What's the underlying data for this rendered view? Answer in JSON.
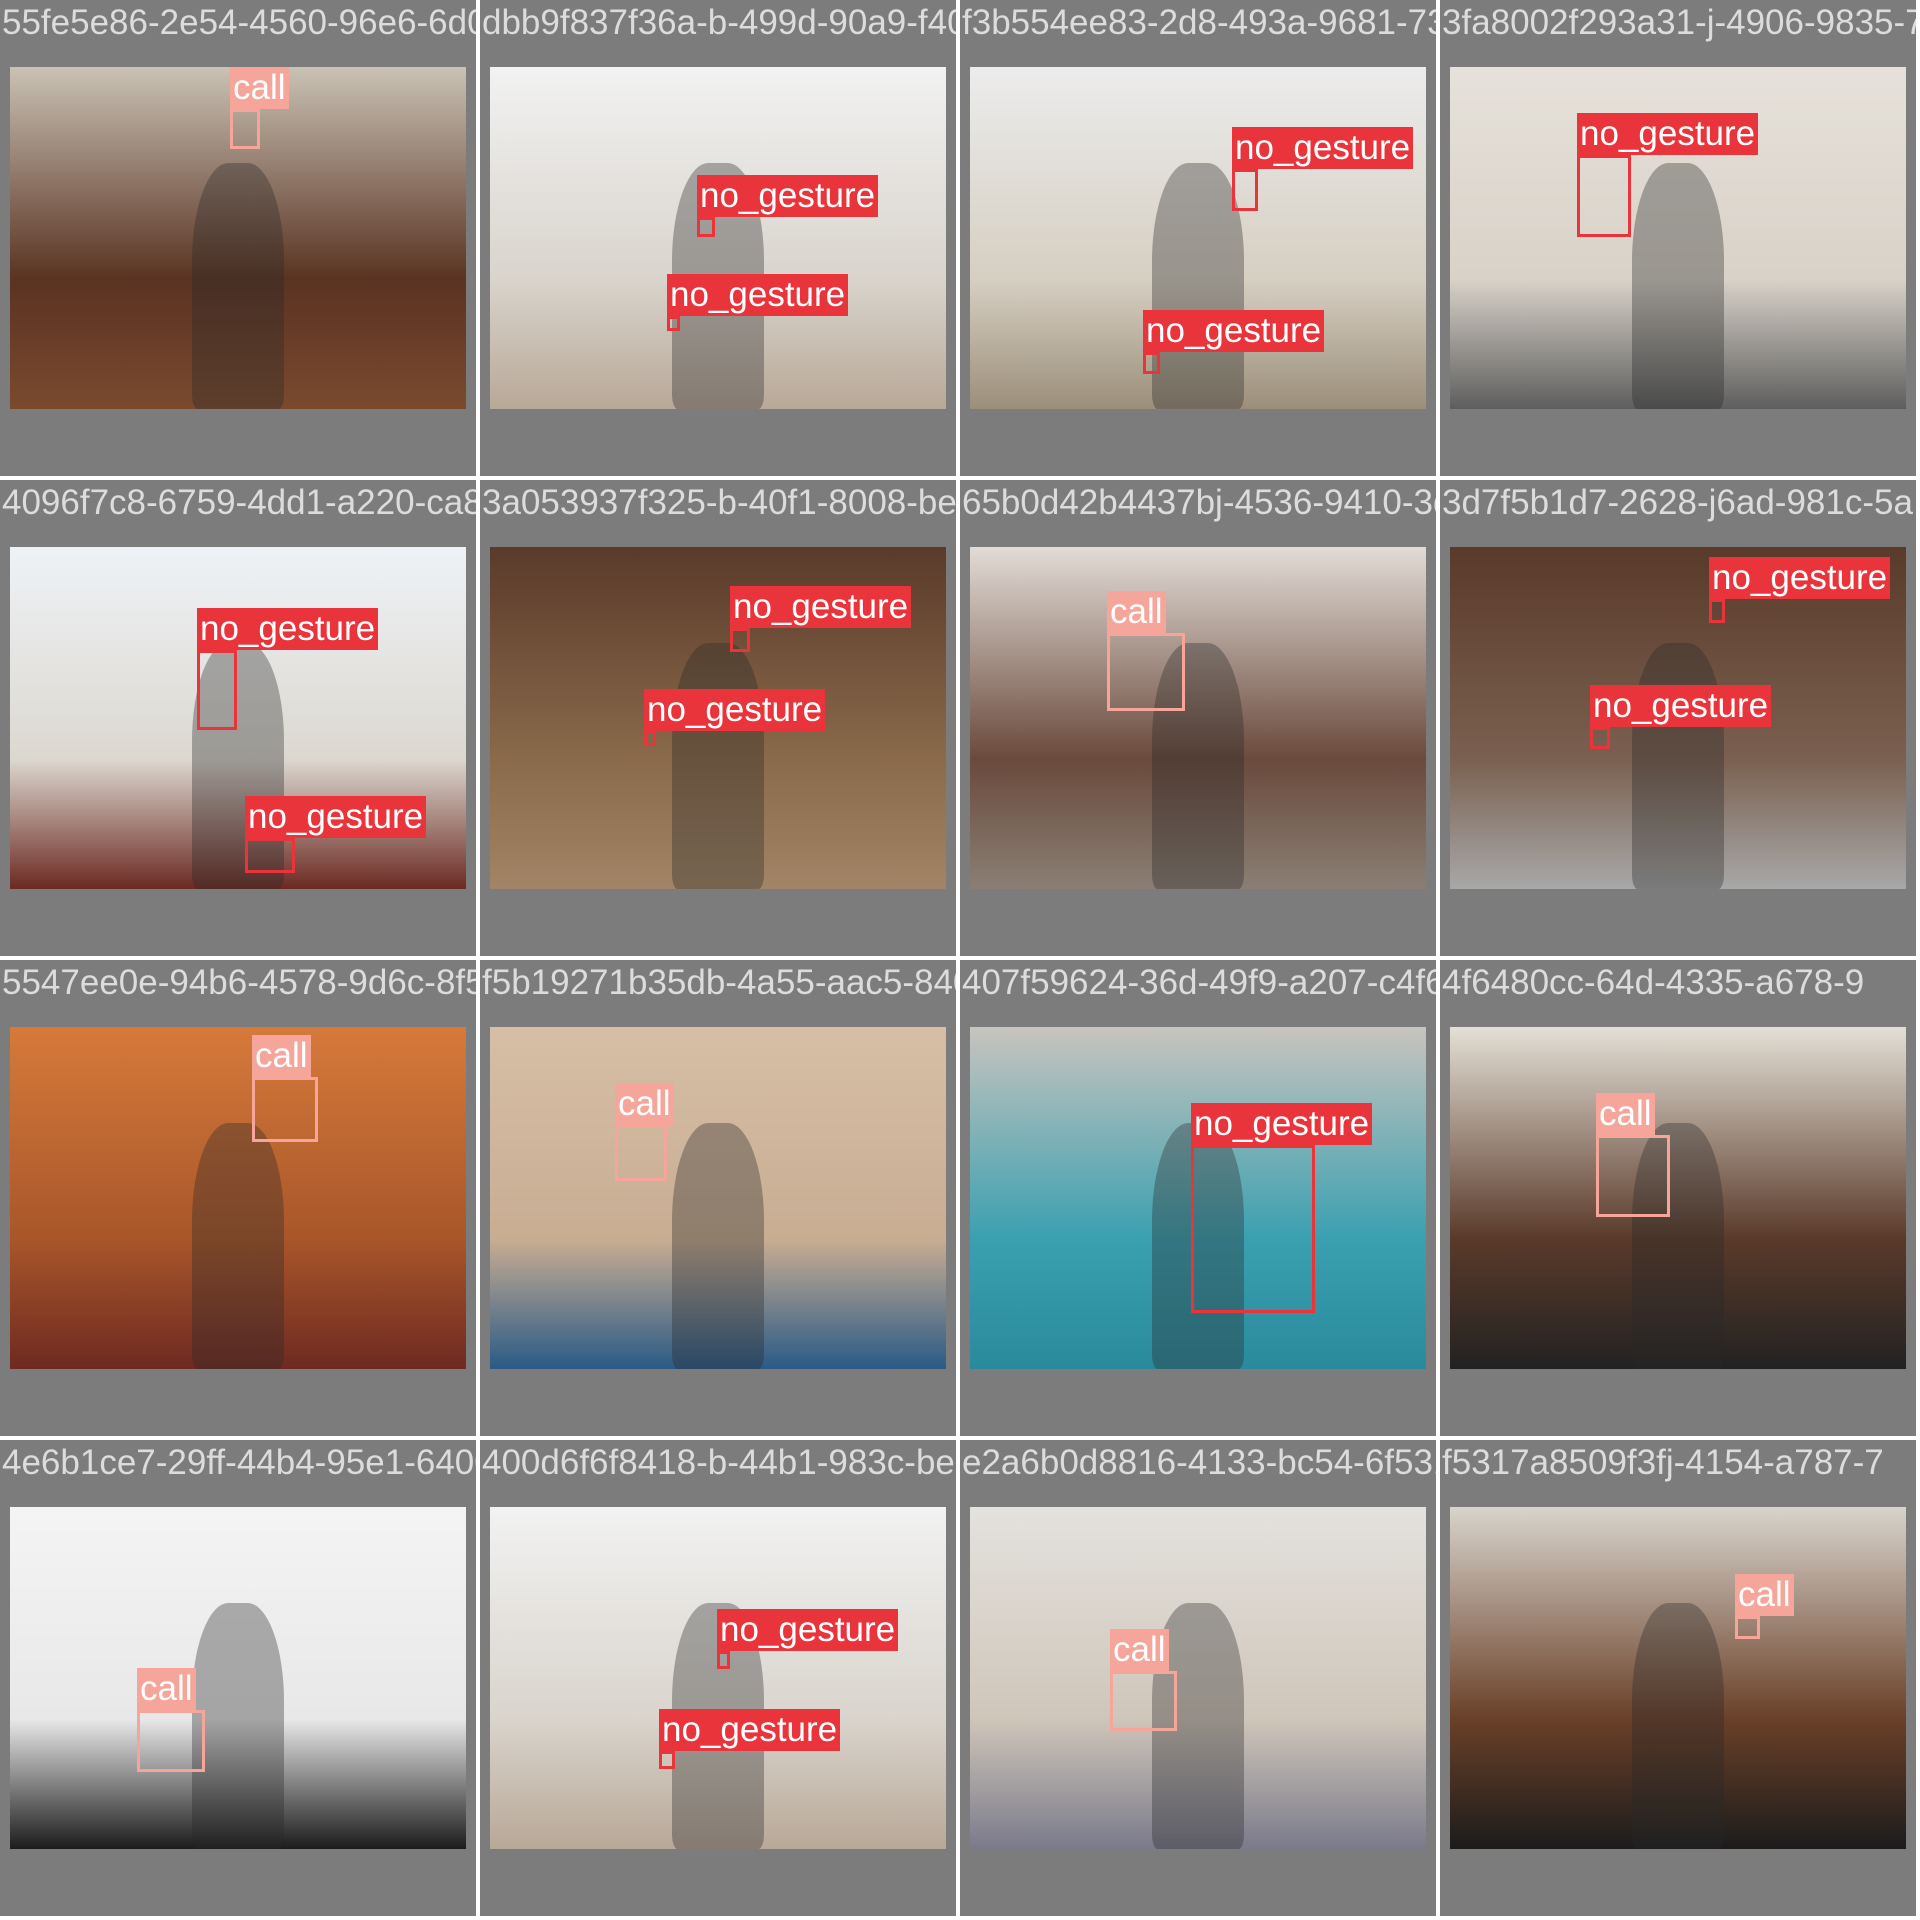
{
  "tiles": [
    {
      "filename": "55fe5e86-2e54-4560-96e6-6d0b9f237f36c.jpg",
      "scene": [
        "#c9c2b5",
        "#5a3322",
        "#7a4a2e"
      ],
      "detections": [
        {
          "label": "call",
          "cls": "call"
        }
      ]
    },
    {
      "filename": "dbb9f837f36a-b-499d-90a9-f40a54ee8-3d8.jpg",
      "scene": [
        "#f2f2f2",
        "#d9d4cc",
        "#b8a898"
      ],
      "detections": [
        {
          "label": "no_gesture",
          "cls": "nog"
        },
        {
          "label": "no_gesture",
          "cls": "nog"
        }
      ]
    },
    {
      "filename": "f3b554ee83-2d8-493a-9681-73a8002f29ca31.jpg",
      "scene": [
        "#ececec",
        "#d6cfc2",
        "#9c8f7a"
      ],
      "detections": [
        {
          "label": "no_gesture",
          "cls": "nog"
        },
        {
          "label": "no_gesture",
          "cls": "nog"
        }
      ]
    },
    {
      "filename": "3fa8002f293a31-j-4906-9835-7",
      "scene": [
        "#e6e1da",
        "#d8d2c8",
        "#5e5e5e"
      ],
      "detections": [
        {
          "label": "no_gesture",
          "cls": "nog"
        }
      ]
    },
    {
      "filename": "4096f7c8-6759-4dd1-a220-ca8d53937f325-b-40f1-8008-be",
      "scene": [
        "#eef2f6",
        "#dcd8d0",
        "#6b2a22"
      ],
      "detections": [
        {
          "label": "no_gesture",
          "cls": "nog"
        },
        {
          "label": "no_gesture",
          "cls": "nog"
        }
      ]
    },
    {
      "filename": "3a053937f325-b-40f1-8008-be65b0d42b4437bj-4536-9410",
      "scene": [
        "#5a3a2a",
        "#8a6a4a",
        "#a28566"
      ],
      "detections": [
        {
          "label": "no_gesture",
          "cls": "nog"
        },
        {
          "label": "no_gesture",
          "cls": "nog"
        }
      ]
    },
    {
      "filename": "65b0d42b4437bj-4536-9410-3d7f5b1d7-2628-j6",
      "scene": [
        "#e2dcd6",
        "#6a4a3c",
        "#8a7f74"
      ],
      "detections": [
        {
          "label": "call",
          "cls": "call"
        }
      ]
    },
    {
      "filename": "3d7f5b1d7-2628-j6ad-981c-5a",
      "scene": [
        "#5a3a2a",
        "#7a6050",
        "#a8a8a8"
      ],
      "detections": [
        {
          "label": "no_gesture",
          "cls": "nog"
        },
        {
          "label": "no_gesture",
          "cls": "nog"
        }
      ]
    },
    {
      "filename": "5547ee0e-94b6-4578-9d6c-8f5b19271b35db-4a55-aac5-8",
      "scene": [
        "#d67a3a",
        "#a8562a",
        "#6e2a22"
      ],
      "detections": [
        {
          "label": "call",
          "cls": "call"
        }
      ]
    },
    {
      "filename": "f5b19271b35db-4a55-aac5-8407f59624-36d-49f9-a207-c",
      "scene": [
        "#d6bfa6",
        "#c8ad92",
        "#2a5a86"
      ],
      "detections": [
        {
          "label": "call",
          "cls": "call"
        }
      ]
    },
    {
      "filename": "407f59624-36d-49f9-a207-c4f6480cc-64d-4335-a678-9",
      "scene": [
        "#c8c4be",
        "#3aa0b0",
        "#2a8a9c"
      ],
      "detections": [
        {
          "label": "no_gesture",
          "cls": "nog"
        }
      ]
    },
    {
      "filename": "4f6480cc-64d-4335-a678-9",
      "scene": [
        "#e4e0d6",
        "#5a3a2a",
        "#222222"
      ],
      "detections": [
        {
          "label": "call",
          "cls": "call"
        }
      ]
    },
    {
      "filename": "4e6b1ce7-29ff-44b4-95e1-6400d6f6f8418-b-44b1-983c-b",
      "scene": [
        "#f4f4f4",
        "#e8e8e8",
        "#1c1c1c"
      ],
      "detections": [
        {
          "label": "call",
          "cls": "call"
        }
      ]
    },
    {
      "filename": "400d6f6f8418-b-44b1-983c-be2a6b0d8816-4133-bc54-6",
      "scene": [
        "#f2f2f2",
        "#d9d4cc",
        "#b8a898"
      ],
      "detections": [
        {
          "label": "no_gesture",
          "cls": "nog"
        },
        {
          "label": "no_gesture",
          "cls": "nog"
        }
      ]
    },
    {
      "filename": "e2a6b0d8816-4133-bc54-6f5317a8509f3fj-4154-a787-7",
      "scene": [
        "#e4e2de",
        "#cfc6ba",
        "#7a7a8a"
      ],
      "detections": [
        {
          "label": "call",
          "cls": "call"
        }
      ]
    },
    {
      "filename": "f5317a8509f3fj-4154-a787-7",
      "scene": [
        "#d8d4cc",
        "#6a4028",
        "#1c1c1c"
      ],
      "detections": [
        {
          "label": "call",
          "cls": "call"
        }
      ]
    }
  ]
}
